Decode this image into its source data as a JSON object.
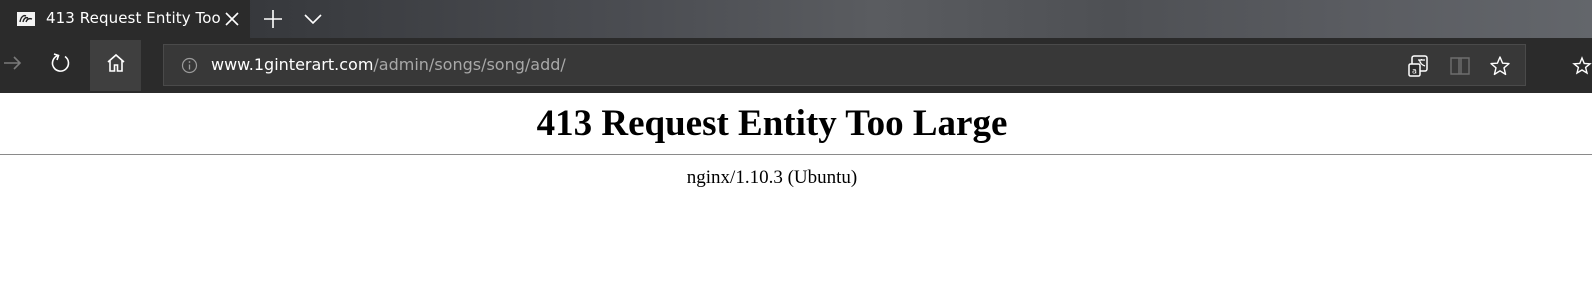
{
  "browser": {
    "tab": {
      "title": "413 Request Entity Too",
      "favicon": "site-favicon",
      "close_icon": "close-icon"
    },
    "tabstrip_icons": {
      "new_tab": "plus-icon",
      "tab_list": "chevron-down-icon"
    },
    "nav_icons": {
      "forward": "arrow-right-icon",
      "refresh": "refresh-icon",
      "home": "home-icon"
    },
    "address_bar": {
      "info_icon": "info-icon",
      "url_host": "www.1ginterart.com",
      "url_path": "/admin/songs/song/add/"
    },
    "address_actions": {
      "translate": "translate-icon",
      "reading_view": "book-icon",
      "favorite": "star-icon"
    },
    "colors": {
      "chrome_dark": "#2b2b2b",
      "address_bar_bg": "#383838",
      "url_host_color": "#ffffff",
      "url_path_color": "#a8a8a8"
    }
  },
  "page": {
    "heading": "413 Request Entity Too Large",
    "server_info": "nginx/1.10.3 (Ubuntu)"
  }
}
